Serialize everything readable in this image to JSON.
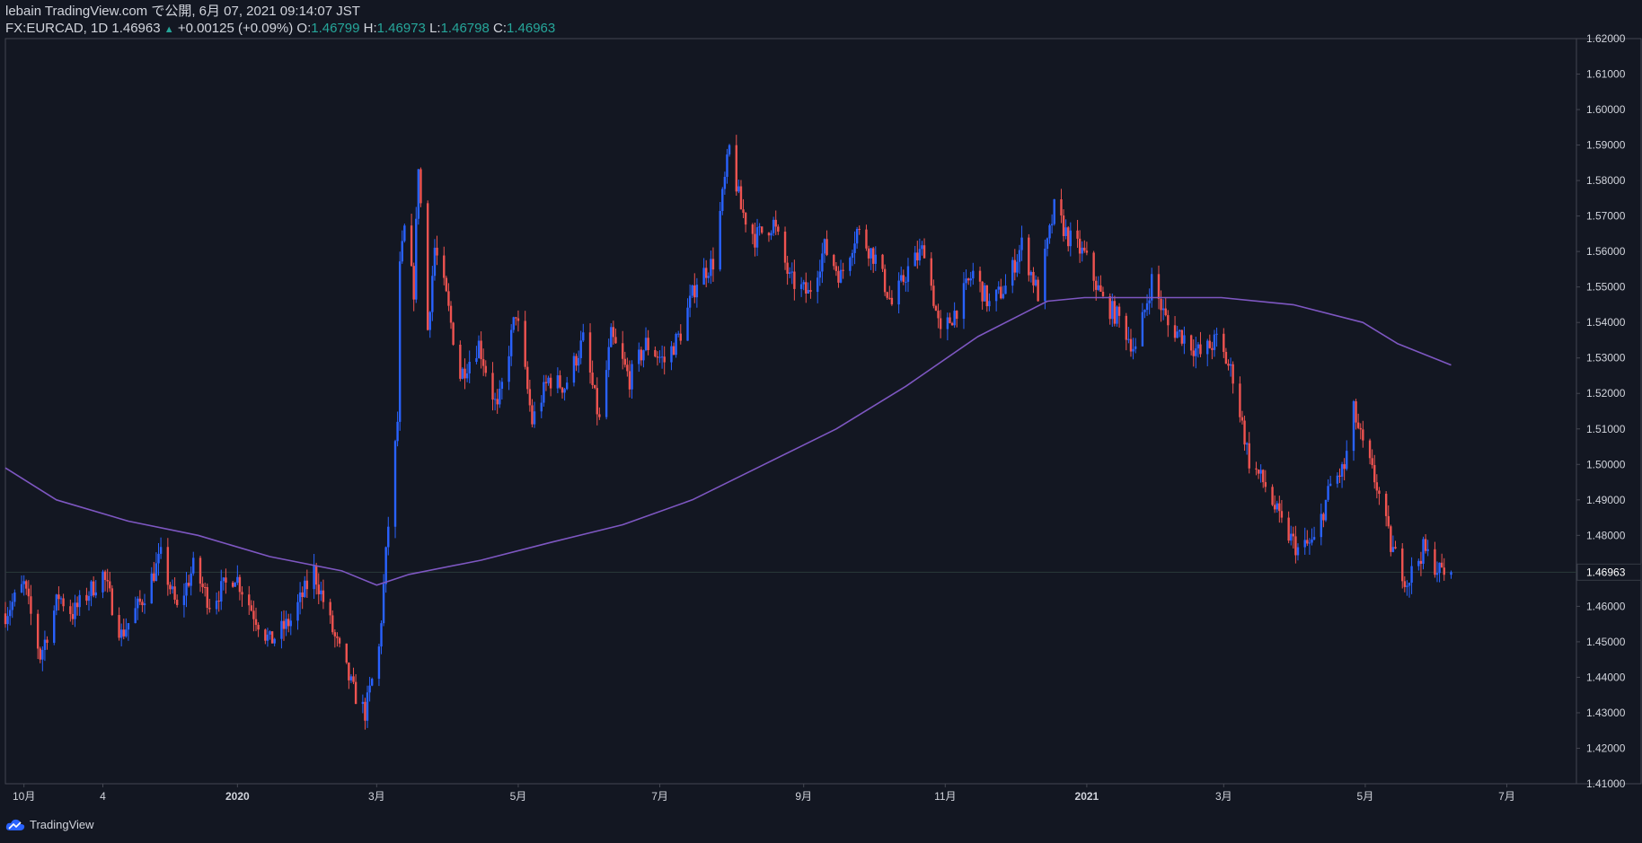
{
  "header": {
    "line1": "lebain TradingView.com で公開, 6月 07, 2021 09:14:07 JST",
    "symbol": "FX:EURCAD, 1D 1.46963",
    "change": "+0.00125 (+0.09%)",
    "o_label": "O:",
    "o_value": "1.46799",
    "h_label": "H:",
    "h_value": "1.46973",
    "l_label": "L:",
    "l_value": "1.46798",
    "c_label": "C:",
    "c_value": "1.46963"
  },
  "footer": {
    "brand": "TradingView"
  },
  "colors": {
    "background": "#131722",
    "up": "#2962ff",
    "down": "#ef5350",
    "ma": "#7e57c2",
    "text": "#d1d4dc",
    "grid": "#363a45"
  },
  "chart_data": {
    "type": "candlestick",
    "symbol": "FX:EURCAD",
    "timeframe": "1D",
    "ylim": [
      1.41,
      1.62
    ],
    "yticks": [
      "1.62000",
      "1.61000",
      "1.60000",
      "1.59000",
      "1.58000",
      "1.57000",
      "1.56000",
      "1.55000",
      "1.54000",
      "1.53000",
      "1.52000",
      "1.51000",
      "1.50000",
      "1.49000",
      "1.48000",
      "1.47000",
      "1.46000",
      "1.45000",
      "1.44000",
      "1.43000",
      "1.42000",
      "1.41000"
    ],
    "last_price_label": "1.46963",
    "last_price": 1.46963,
    "xlim": [
      "2019-09-23",
      "2021-07-31"
    ],
    "xticks": [
      {
        "date": "2019-10-01",
        "label": "10月",
        "bold": false
      },
      {
        "date": "2019-11-04",
        "label": "4",
        "bold": false
      },
      {
        "date": "2020-01-01",
        "label": "2020",
        "bold": true
      },
      {
        "date": "2020-03-01",
        "label": "3月",
        "bold": false
      },
      {
        "date": "2020-05-01",
        "label": "5月",
        "bold": false
      },
      {
        "date": "2020-07-01",
        "label": "7月",
        "bold": false
      },
      {
        "date": "2020-09-01",
        "label": "9月",
        "bold": false
      },
      {
        "date": "2020-11-01",
        "label": "11月",
        "bold": false
      },
      {
        "date": "2021-01-01",
        "label": "2021",
        "bold": true
      },
      {
        "date": "2021-03-01",
        "label": "3月",
        "bold": false
      },
      {
        "date": "2021-05-01",
        "label": "5月",
        "bold": false
      },
      {
        "date": "2021-07-01",
        "label": "7月",
        "bold": false
      }
    ],
    "price_anchors": [
      [
        "2019-09-23",
        1.458
      ],
      [
        "2019-10-01",
        1.466
      ],
      [
        "2019-10-08",
        1.446
      ],
      [
        "2019-10-16",
        1.463
      ],
      [
        "2019-10-22",
        1.458
      ],
      [
        "2019-11-04",
        1.469
      ],
      [
        "2019-11-12",
        1.452
      ],
      [
        "2019-11-21",
        1.462
      ],
      [
        "2019-11-29",
        1.474
      ],
      [
        "2019-12-06",
        1.459
      ],
      [
        "2019-12-13",
        1.471
      ],
      [
        "2019-12-20",
        1.461
      ],
      [
        "2019-12-31",
        1.469
      ],
      [
        "2020-01-08",
        1.458
      ],
      [
        "2020-01-15",
        1.45
      ],
      [
        "2020-01-24",
        1.456
      ],
      [
        "2020-02-03",
        1.47
      ],
      [
        "2020-02-12",
        1.451
      ],
      [
        "2020-02-20",
        1.436
      ],
      [
        "2020-02-25",
        1.43
      ],
      [
        "2020-03-02",
        1.448
      ],
      [
        "2020-03-06",
        1.483
      ],
      [
        "2020-03-10",
        1.512
      ],
      [
        "2020-03-11",
        1.555
      ],
      [
        "2020-03-13",
        1.566
      ],
      [
        "2020-03-17",
        1.549
      ],
      [
        "2020-03-19",
        1.585
      ],
      [
        "2020-03-23",
        1.538
      ],
      [
        "2020-03-26",
        1.561
      ],
      [
        "2020-03-31",
        1.547
      ],
      [
        "2020-04-06",
        1.525
      ],
      [
        "2020-04-14",
        1.534
      ],
      [
        "2020-04-22",
        1.515
      ],
      [
        "2020-04-30",
        1.543
      ],
      [
        "2020-05-07",
        1.512
      ],
      [
        "2020-05-14",
        1.524
      ],
      [
        "2020-05-21",
        1.522
      ],
      [
        "2020-05-29",
        1.535
      ],
      [
        "2020-06-05",
        1.512
      ],
      [
        "2020-06-10",
        1.536
      ],
      [
        "2020-06-18",
        1.524
      ],
      [
        "2020-06-25",
        1.534
      ],
      [
        "2020-07-03",
        1.529
      ],
      [
        "2020-07-10",
        1.537
      ],
      [
        "2020-07-17",
        1.552
      ],
      [
        "2020-07-24",
        1.557
      ],
      [
        "2020-07-31",
        1.589
      ],
      [
        "2020-08-05",
        1.572
      ],
      [
        "2020-08-11",
        1.564
      ],
      [
        "2020-08-19",
        1.568
      ],
      [
        "2020-08-26",
        1.552
      ],
      [
        "2020-09-03",
        1.548
      ],
      [
        "2020-09-10",
        1.561
      ],
      [
        "2020-09-17",
        1.553
      ],
      [
        "2020-09-24",
        1.566
      ],
      [
        "2020-10-02",
        1.558
      ],
      [
        "2020-10-09",
        1.545
      ],
      [
        "2020-10-16",
        1.555
      ],
      [
        "2020-10-23",
        1.561
      ],
      [
        "2020-10-30",
        1.536
      ],
      [
        "2020-11-06",
        1.544
      ],
      [
        "2020-11-13",
        1.554
      ],
      [
        "2020-11-20",
        1.545
      ],
      [
        "2020-11-27",
        1.55
      ],
      [
        "2020-12-04",
        1.562
      ],
      [
        "2020-12-11",
        1.548
      ],
      [
        "2020-12-18",
        1.572
      ],
      [
        "2020-12-24",
        1.564
      ],
      [
        "2020-12-31",
        1.559
      ],
      [
        "2021-01-08",
        1.546
      ],
      [
        "2021-01-15",
        1.541
      ],
      [
        "2021-01-22",
        1.532
      ],
      [
        "2021-01-29",
        1.552
      ],
      [
        "2021-02-05",
        1.539
      ],
      [
        "2021-02-12",
        1.536
      ],
      [
        "2021-02-19",
        1.531
      ],
      [
        "2021-02-26",
        1.535
      ],
      [
        "2021-03-05",
        1.525
      ],
      [
        "2021-03-12",
        1.501
      ],
      [
        "2021-03-19",
        1.494
      ],
      [
        "2021-03-26",
        1.483
      ],
      [
        "2021-04-02",
        1.476
      ],
      [
        "2021-04-09",
        1.478
      ],
      [
        "2021-04-16",
        1.494
      ],
      [
        "2021-04-22",
        1.499
      ],
      [
        "2021-04-26",
        1.515
      ],
      [
        "2021-04-30",
        1.505
      ],
      [
        "2021-05-06",
        1.494
      ],
      [
        "2021-05-12",
        1.477
      ],
      [
        "2021-05-19",
        1.467
      ],
      [
        "2021-05-26",
        1.476
      ],
      [
        "2021-06-02",
        1.47
      ],
      [
        "2021-06-07",
        1.46963
      ]
    ],
    "ma_line": [
      [
        "2019-09-23",
        1.499
      ],
      [
        "2019-10-15",
        1.49
      ],
      [
        "2019-11-15",
        1.484
      ],
      [
        "2019-12-15",
        1.48
      ],
      [
        "2020-01-15",
        1.474
      ],
      [
        "2020-02-15",
        1.47
      ],
      [
        "2020-03-01",
        1.466
      ],
      [
        "2020-03-15",
        1.469
      ],
      [
        "2020-04-15",
        1.473
      ],
      [
        "2020-05-15",
        1.478
      ],
      [
        "2020-06-15",
        1.483
      ],
      [
        "2020-07-15",
        1.49
      ],
      [
        "2020-08-15",
        1.5
      ],
      [
        "2020-09-15",
        1.51
      ],
      [
        "2020-10-15",
        1.522
      ],
      [
        "2020-11-15",
        1.536
      ],
      [
        "2020-12-15",
        1.546
      ],
      [
        "2020-12-31",
        1.547
      ],
      [
        "2021-01-31",
        1.547
      ],
      [
        "2021-02-28",
        1.547
      ],
      [
        "2021-03-31",
        1.545
      ],
      [
        "2021-04-30",
        1.54
      ],
      [
        "2021-05-15",
        1.534
      ],
      [
        "2021-06-07",
        1.528
      ]
    ]
  }
}
